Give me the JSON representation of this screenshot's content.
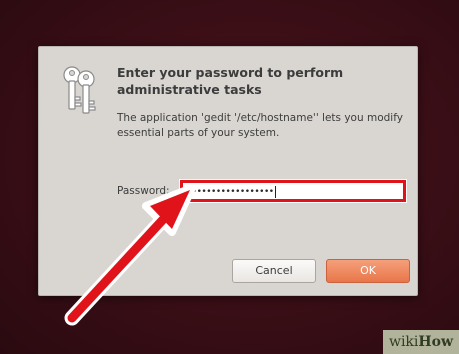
{
  "dialog": {
    "title": "Enter your password to perform administrative tasks",
    "description": "The application 'gedit '/etc/hostname'' lets you modify essential parts of your system.",
    "password_label": "Password:",
    "password_value": "••••••••••••••••••",
    "cancel_label": "Cancel",
    "ok_label": "OK"
  },
  "watermark": {
    "prefix": "wiki",
    "suffix": "How"
  },
  "colors": {
    "highlight_red": "#e0131b",
    "ok_button": "#e9754a",
    "dialog_bg": "#d9d6d2"
  },
  "icons": [
    "keys-icon",
    "annotation-arrow"
  ]
}
